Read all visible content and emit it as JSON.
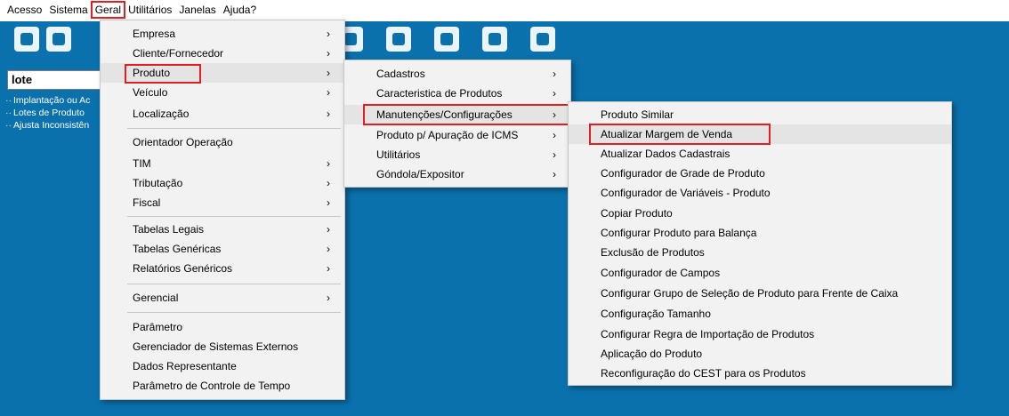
{
  "menubar": {
    "items": [
      "Acesso",
      "Sistema",
      "Geral",
      "Utilitários",
      "Janelas",
      "Ajuda?"
    ]
  },
  "left_panel": {
    "search_value": "lote",
    "tree": [
      "Implantação ou Ac",
      "Lotes de Produto",
      "Ajusta Inconsistên"
    ]
  },
  "toolbar": {
    "icons": [
      "unlock-icon",
      "lock-icon",
      "document-money-icon",
      "box-icon",
      "handshake-icon",
      "document-list-icon",
      "money-cycle-icon",
      "monitor-money-icon",
      "factory-icon",
      "open-mail-icon",
      "users-icon",
      "leaf-icon",
      "phone-document-icon",
      "edit-document-icon"
    ]
  },
  "geral_menu": {
    "items": [
      {
        "label": "Empresa",
        "arrow": true
      },
      {
        "label": "Cliente/Fornecedor",
        "arrow": true
      },
      {
        "label": "Produto",
        "arrow": true
      },
      {
        "label": "Veículo",
        "arrow": true
      },
      {
        "label": "Localização",
        "arrow": true
      },
      {
        "label": "Orientador Operação",
        "arrow": false
      },
      {
        "label": "TIM",
        "arrow": true
      },
      {
        "label": "Tributação",
        "arrow": true
      },
      {
        "label": "Fiscal",
        "arrow": true
      },
      {
        "label": "Tabelas Legais",
        "arrow": true
      },
      {
        "label": "Tabelas Genéricas",
        "arrow": true
      },
      {
        "label": "Relatórios Genéricos",
        "arrow": true
      },
      {
        "label": "Gerencial",
        "arrow": true
      },
      {
        "label": "Parâmetro",
        "arrow": false
      },
      {
        "label": "Gerenciador de Sistemas Externos",
        "arrow": false
      },
      {
        "label": "Dados Representante",
        "arrow": false
      },
      {
        "label": "Parâmetro de Controle de Tempo",
        "arrow": false
      }
    ]
  },
  "produto_menu": {
    "items": [
      {
        "label": "Cadastros",
        "arrow": true
      },
      {
        "label": "Caracteristica de Produtos",
        "arrow": true
      },
      {
        "label": "Manutenções/Configurações",
        "arrow": true
      },
      {
        "label": "Produto p/ Apuração de ICMS",
        "arrow": true
      },
      {
        "label": "Utilitários",
        "arrow": true
      },
      {
        "label": "Góndola/Expositor",
        "arrow": true
      }
    ]
  },
  "manut_menu": {
    "items": [
      "Produto Similar",
      "Atualizar Margem de Venda",
      "Atualizar Dados Cadastrais",
      "Configurador de Grade de Produto",
      "Configurador de Variáveis - Produto",
      "Copiar Produto",
      "Configurar Produto para Balança",
      "Exclusão de Produtos",
      "Configurador de Campos",
      "Configurar Grupo de Seleção de Produto para Frente de Caixa",
      "Configuração Tamanho",
      "Configurar Regra de Importação de Produtos",
      "Aplicação do Produto",
      "Reconfiguração do CEST para os Produtos"
    ]
  },
  "arrow_glyph": "›",
  "colors": {
    "workspace": "#0b71ad",
    "highlight": "#e02020",
    "menu_bg": "#f2f2f2"
  }
}
